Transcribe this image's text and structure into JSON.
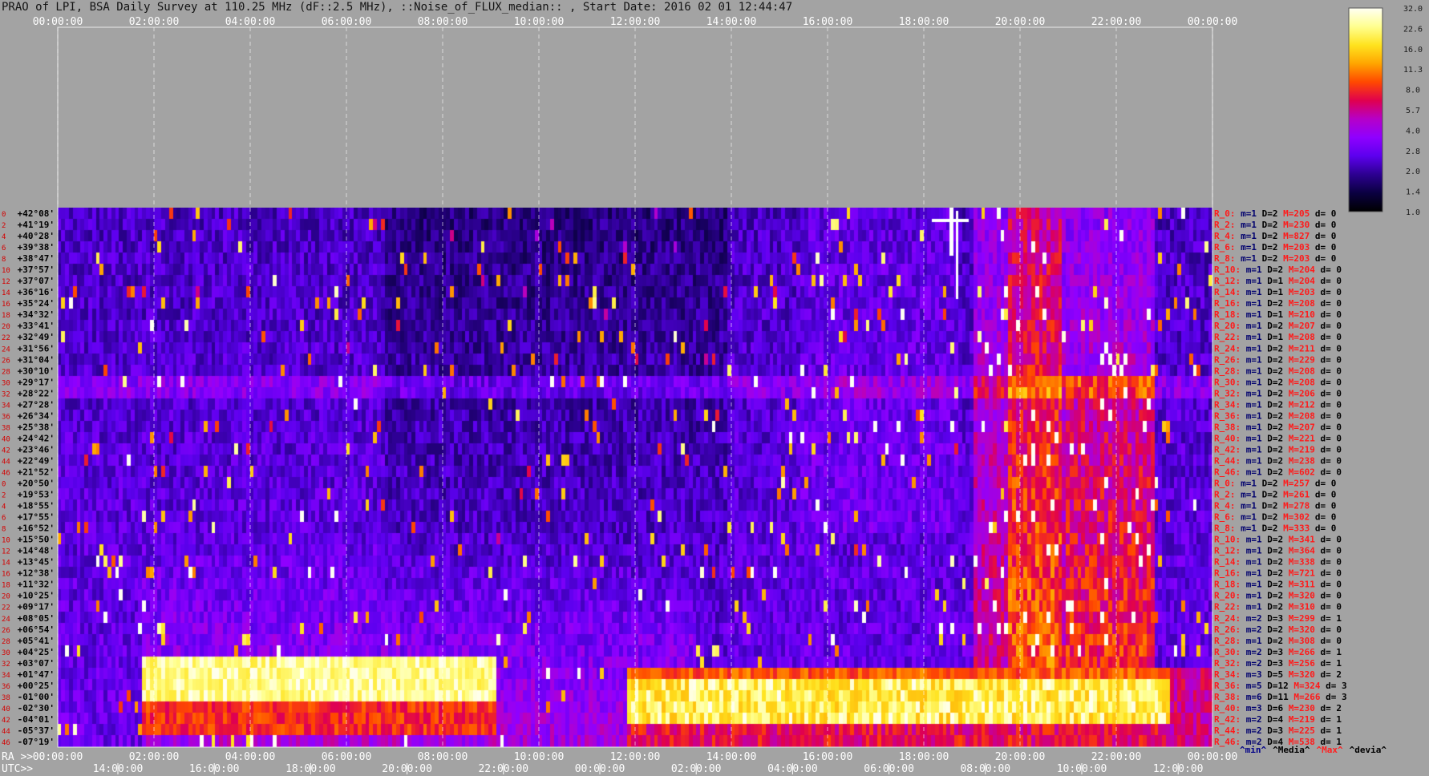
{
  "title": "PRAO of LPI, BSA Daily Survey at 110.25 MHz (dF::2.5 MHz), ::Noise_of_FLUX_median:: , Start Date: 2016 02 01 12:44:47",
  "chart_data": {
    "type": "heatmap",
    "top_time_ticks": [
      "00:00:00",
      "02:00:00",
      "04:00:00",
      "06:00:00",
      "08:00:00",
      "10:00:00",
      "12:00:00",
      "14:00:00",
      "16:00:00",
      "18:00:00",
      "20:00:00",
      "22:00:00",
      "00:00:00"
    ],
    "ra_axis_label": "RA >>",
    "ra_ticks": [
      "00:00:00",
      "02:00:00",
      "04:00:00",
      "06:00:00",
      "08:00:00",
      "10:00:00",
      "12:00:00",
      "14:00:00",
      "16:00:00",
      "18:00:00",
      "20:00:00",
      "22:00:00",
      "00:00:00"
    ],
    "utc_axis_label": "UTC>>",
    "utc_ticks": [
      "14:00:00",
      "16:00:00",
      "18:00:00",
      "20:00:00",
      "22:00:00",
      "00:00:00",
      "02:00:00",
      "04:00:00",
      "06:00:00",
      "08:00:00",
      "10:00:00",
      "12:00:00"
    ],
    "row_numbers": [
      "0",
      "2",
      "4",
      "6",
      "8",
      "10",
      "12",
      "14",
      "16",
      "18",
      "20",
      "22",
      "24",
      "26",
      "28",
      "30",
      "32",
      "34",
      "36",
      "38",
      "40",
      "42",
      "44",
      "46",
      "0",
      "2",
      "4",
      "6",
      "8",
      "10",
      "12",
      "14",
      "16",
      "18",
      "20",
      "22",
      "24",
      "26",
      "28",
      "30",
      "32",
      "34",
      "36",
      "38",
      "40",
      "42",
      "44",
      "46"
    ],
    "declinations": [
      "+42°08'",
      "+41°19'",
      "+40°28'",
      "+39°38'",
      "+38°47'",
      "+37°57'",
      "+37°07'",
      "+36°16'",
      "+35°24'",
      "+34°32'",
      "+33°41'",
      "+32°49'",
      "+31°56'",
      "+31°04'",
      "+30°10'",
      "+29°17'",
      "+28°22'",
      "+27°28'",
      "+26°34'",
      "+25°38'",
      "+24°42'",
      "+23°46'",
      "+22°49'",
      "+21°52'",
      "+20°50'",
      "+19°53'",
      "+18°55'",
      "+17°55'",
      "+16°52'",
      "+15°50'",
      "+14°48'",
      "+13°45'",
      "+12°38'",
      "+11°32'",
      "+10°25'",
      "+09°17'",
      "+08°05'",
      "+06°54'",
      "+05°41'",
      "+04°25'",
      "+03°07'",
      "+01°47'",
      "+00°25'",
      "-01°00'",
      "-02°30'",
      "-04°01'",
      "-05°37'",
      "-07°19'"
    ],
    "beam_stats": [
      {
        "r": "R_0:",
        "m": "m=1",
        "D": "D=2",
        "M": "M=205",
        "d": "d= 0"
      },
      {
        "r": "R_2:",
        "m": "m=1",
        "D": "D=2",
        "M": "M=230",
        "d": "d= 0"
      },
      {
        "r": "R_4:",
        "m": "m=1",
        "D": "D=2",
        "M": "M=827",
        "d": "d= 0"
      },
      {
        "r": "R_6:",
        "m": "m=1",
        "D": "D=2",
        "M": "M=203",
        "d": "d= 0"
      },
      {
        "r": "R_8:",
        "m": "m=1",
        "D": "D=2",
        "M": "M=203",
        "d": "d= 0"
      },
      {
        "r": "R_10:",
        "m": "m=1",
        "D": "D=2",
        "M": "M=204",
        "d": "d= 0"
      },
      {
        "r": "R_12:",
        "m": "m=1",
        "D": "D=1",
        "M": "M=204",
        "d": "d= 0"
      },
      {
        "r": "R_14:",
        "m": "m=1",
        "D": "D=1",
        "M": "M=203",
        "d": "d= 0"
      },
      {
        "r": "R_16:",
        "m": "m=1",
        "D": "D=2",
        "M": "M=208",
        "d": "d= 0"
      },
      {
        "r": "R_18:",
        "m": "m=1",
        "D": "D=1",
        "M": "M=210",
        "d": "d= 0"
      },
      {
        "r": "R_20:",
        "m": "m=1",
        "D": "D=2",
        "M": "M=207",
        "d": "d= 0"
      },
      {
        "r": "R_22:",
        "m": "m=1",
        "D": "D=1",
        "M": "M=208",
        "d": "d= 0"
      },
      {
        "r": "R_24:",
        "m": "m=1",
        "D": "D=2",
        "M": "M=211",
        "d": "d= 0"
      },
      {
        "r": "R_26:",
        "m": "m=1",
        "D": "D=2",
        "M": "M=229",
        "d": "d= 0"
      },
      {
        "r": "R_28:",
        "m": "m=1",
        "D": "D=2",
        "M": "M=208",
        "d": "d= 0"
      },
      {
        "r": "R_30:",
        "m": "m=1",
        "D": "D=2",
        "M": "M=208",
        "d": "d= 0"
      },
      {
        "r": "R_32:",
        "m": "m=1",
        "D": "D=2",
        "M": "M=206",
        "d": "d= 0"
      },
      {
        "r": "R_34:",
        "m": "m=1",
        "D": "D=2",
        "M": "M=212",
        "d": "d= 0"
      },
      {
        "r": "R_36:",
        "m": "m=1",
        "D": "D=2",
        "M": "M=208",
        "d": "d= 0"
      },
      {
        "r": "R_38:",
        "m": "m=1",
        "D": "D=2",
        "M": "M=207",
        "d": "d= 0"
      },
      {
        "r": "R_40:",
        "m": "m=1",
        "D": "D=2",
        "M": "M=221",
        "d": "d= 0"
      },
      {
        "r": "R_42:",
        "m": "m=1",
        "D": "D=2",
        "M": "M=219",
        "d": "d= 0"
      },
      {
        "r": "R_44:",
        "m": "m=1",
        "D": "D=2",
        "M": "M=238",
        "d": "d= 0"
      },
      {
        "r": "R_46:",
        "m": "m=1",
        "D": "D=2",
        "M": "M=602",
        "d": "d= 0"
      },
      {
        "r": "R_0:",
        "m": "m=1",
        "D": "D=2",
        "M": "M=257",
        "d": "d= 0"
      },
      {
        "r": "R_2:",
        "m": "m=1",
        "D": "D=2",
        "M": "M=261",
        "d": "d= 0"
      },
      {
        "r": "R_4:",
        "m": "m=1",
        "D": "D=2",
        "M": "M=278",
        "d": "d= 0"
      },
      {
        "r": "R_6:",
        "m": "m=1",
        "D": "D=2",
        "M": "M=302",
        "d": "d= 0"
      },
      {
        "r": "R_8:",
        "m": "m=1",
        "D": "D=2",
        "M": "M=333",
        "d": "d= 0"
      },
      {
        "r": "R_10:",
        "m": "m=1",
        "D": "D=2",
        "M": "M=341",
        "d": "d= 0"
      },
      {
        "r": "R_12:",
        "m": "m=1",
        "D": "D=2",
        "M": "M=364",
        "d": "d= 0"
      },
      {
        "r": "R_14:",
        "m": "m=1",
        "D": "D=2",
        "M": "M=338",
        "d": "d= 0"
      },
      {
        "r": "R_16:",
        "m": "m=1",
        "D": "D=2",
        "M": "M=721",
        "d": "d= 0"
      },
      {
        "r": "R_18:",
        "m": "m=1",
        "D": "D=2",
        "M": "M=311",
        "d": "d= 0"
      },
      {
        "r": "R_20:",
        "m": "m=1",
        "D": "D=2",
        "M": "M=320",
        "d": "d= 0"
      },
      {
        "r": "R_22:",
        "m": "m=1",
        "D": "D=2",
        "M": "M=310",
        "d": "d= 0"
      },
      {
        "r": "R_24:",
        "m": "m=2",
        "D": "D=3",
        "M": "M=299",
        "d": "d= 1"
      },
      {
        "r": "R_26:",
        "m": "m=2",
        "D": "D=2",
        "M": "M=320",
        "d": "d= 0"
      },
      {
        "r": "R_28:",
        "m": "m=1",
        "D": "D=2",
        "M": "M=308",
        "d": "d= 0"
      },
      {
        "r": "R_30:",
        "m": "m=2",
        "D": "D=3",
        "M": "M=266",
        "d": "d= 1"
      },
      {
        "r": "R_32:",
        "m": "m=2",
        "D": "D=3",
        "M": "M=256",
        "d": "d= 1"
      },
      {
        "r": "R_34:",
        "m": "m=3",
        "D": "D=5",
        "M": "M=320",
        "d": "d= 2"
      },
      {
        "r": "R_36:",
        "m": "m=5",
        "D": "D=12",
        "M": "M=324",
        "d": "d= 3"
      },
      {
        "r": "R_38:",
        "m": "m=6",
        "D": "D=11",
        "M": "M=266",
        "d": "d= 3"
      },
      {
        "r": "R_40:",
        "m": "m=3",
        "D": "D=6",
        "M": "M=230",
        "d": "d= 2"
      },
      {
        "r": "R_42:",
        "m": "m=2",
        "D": "D=4",
        "M": "M=219",
        "d": "d= 1"
      },
      {
        "r": "R_44:",
        "m": "m=2",
        "D": "D=3",
        "M": "M=225",
        "d": "d= 1"
      },
      {
        "r": "R_46:",
        "m": "m=2",
        "D": "D=4",
        "M": "M=538",
        "d": "d= 1"
      }
    ],
    "colorbar": {
      "ticks": [
        "32.0",
        "22.6",
        "16.0",
        "11.3",
        "8.0",
        "5.7",
        "4.0",
        "2.8",
        "2.0",
        "1.4",
        "1.0"
      ],
      "range": [
        1.0,
        32.0
      ],
      "scale": "log",
      "colors": [
        "#fffff4",
        "#ffff90",
        "#ffe31f",
        "#ffa500",
        "#ff4800",
        "#e0004f",
        "#b600c8",
        "#8f00ff",
        "#5c00ee",
        "#2c0090",
        "#0a0040",
        "#000000"
      ]
    },
    "legend": [
      {
        "label": "^min^",
        "color": "#000088"
      },
      {
        "label": "^Media^",
        "color": "#000000"
      },
      {
        "label": "^Max^",
        "color": "#ff2020"
      },
      {
        "label": "^devia^",
        "color": "#000000"
      }
    ],
    "colors": {
      "background": "#a3a3a3",
      "axis_text": "#ffffff",
      "dec_text": "#000000",
      "row_number": "#d40000",
      "stat_red": "#ff1a1a",
      "stat_blue": "#00006e",
      "stat_black": "#000000"
    }
  }
}
